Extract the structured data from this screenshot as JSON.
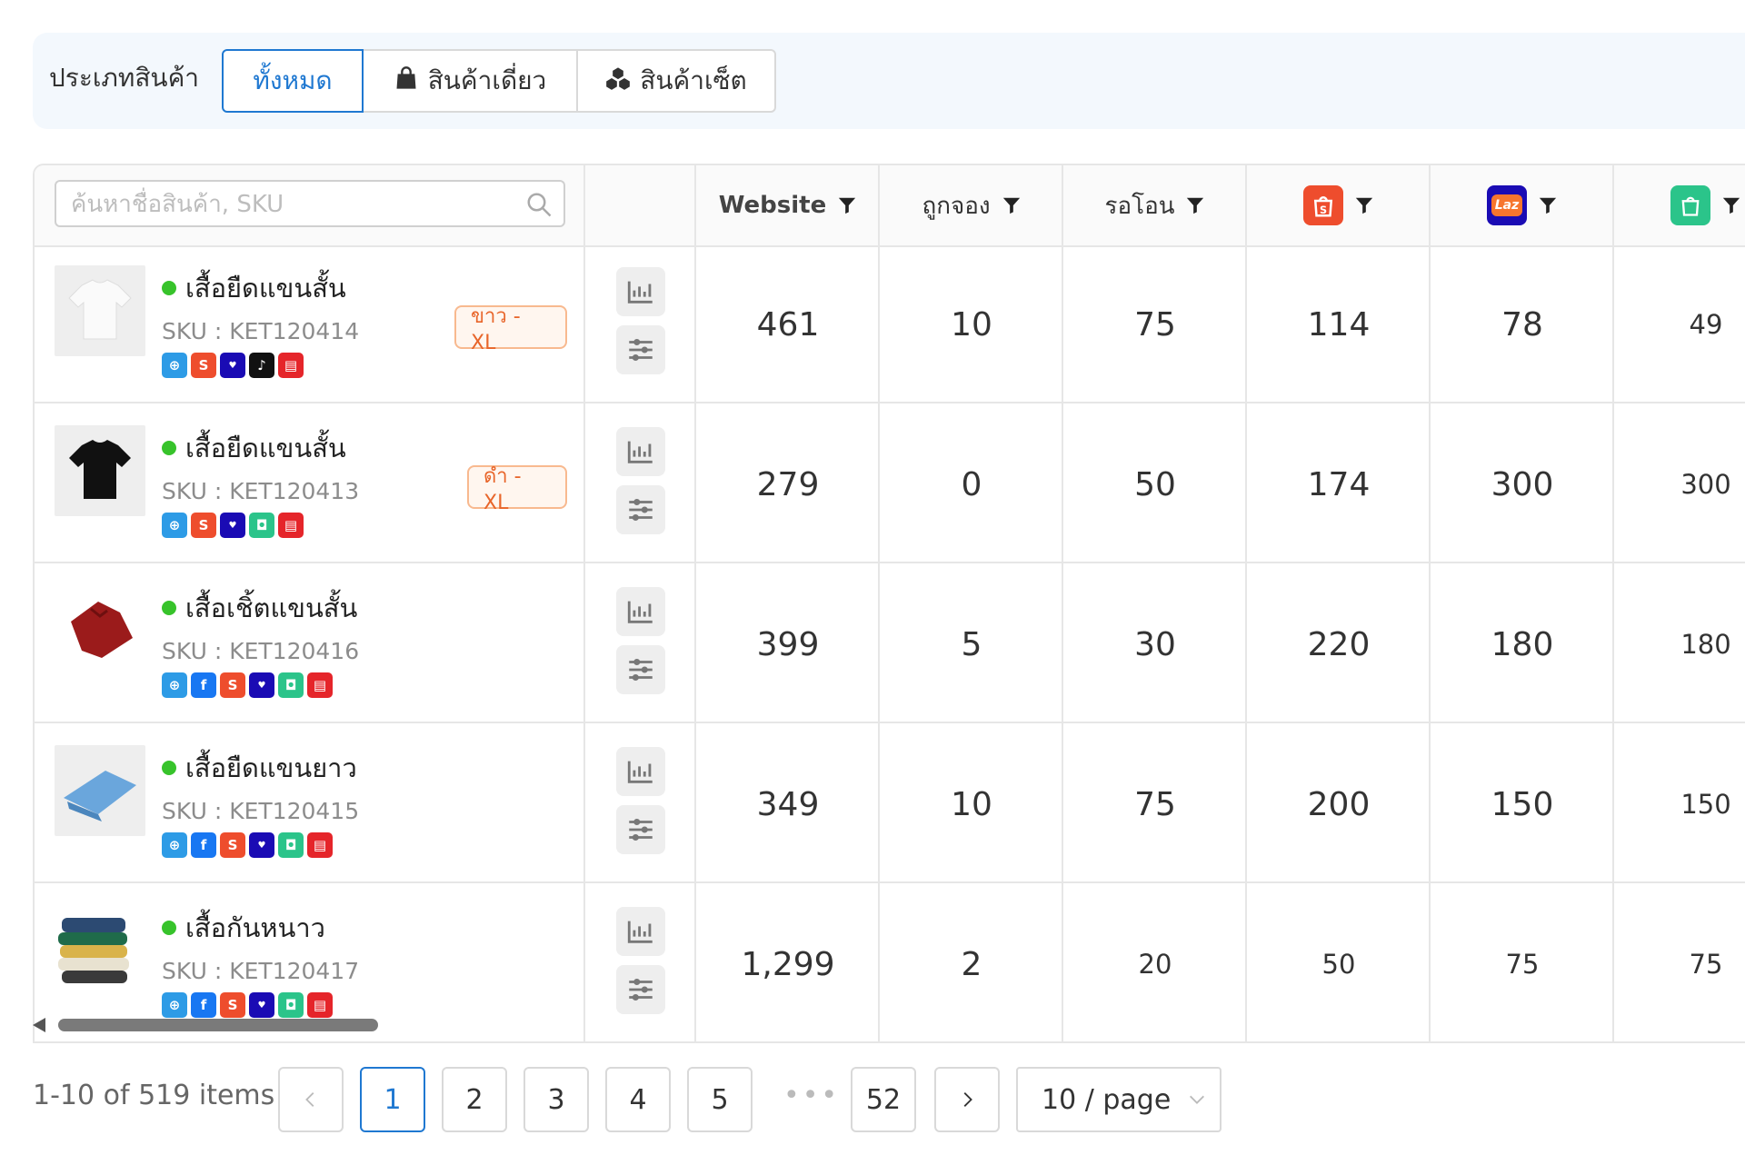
{
  "filter": {
    "label": "ประเภทสินค้า",
    "tabs": [
      {
        "label": "ทั้งหมด",
        "icon": "",
        "active": true
      },
      {
        "label": "สินค้าเดี่ยว",
        "icon": "shopping-bag-icon",
        "active": false
      },
      {
        "label": "สินค้าเซ็ต",
        "icon": "cubes-icon",
        "active": false
      }
    ]
  },
  "search": {
    "placeholder": "ค้นหาชื่อสินค้า, SKU",
    "value": ""
  },
  "columns": {
    "website": "Website",
    "reserved": "ถูกจอง",
    "pending": "รอโอน",
    "shopee_icon": "shopee-logo-icon",
    "lazada_icon": "lazada-logo-icon",
    "lazada_text": "Laz",
    "line_icon": "line-shopping-logo-icon"
  },
  "colors": {
    "accent": "#1f78d1",
    "shopee": "#ee4d2d",
    "lazada": "#1a0bb4",
    "line_shopping": "#2bc48a",
    "status_active": "#37c32b",
    "variant_text": "#e8652a"
  },
  "products": [
    {
      "name": "เสื้อยืดแขนสั้น",
      "sku": "SKU : KET120414",
      "variant": "ขาว - XL",
      "channels": [
        "website",
        "shopee",
        "lazada",
        "tiktok",
        "pos"
      ],
      "stock": {
        "website": "461",
        "reserved": "10",
        "pending": "75",
        "shopee": "114",
        "lazada": "78",
        "line": "49"
      }
    },
    {
      "name": "เสื้อยืดแขนสั้น",
      "sku": "SKU : KET120413",
      "variant": "ดำ - XL",
      "channels": [
        "website",
        "shopee",
        "lazada",
        "line",
        "pos"
      ],
      "stock": {
        "website": "279",
        "reserved": "0",
        "pending": "50",
        "shopee": "174",
        "lazada": "300",
        "line": "300"
      }
    },
    {
      "name": "เสื้อเชิ้ตแขนสั้น",
      "sku": "SKU : KET120416",
      "variant": "",
      "channels": [
        "website",
        "facebook",
        "shopee",
        "lazada",
        "line",
        "pos"
      ],
      "stock": {
        "website": "399",
        "reserved": "5",
        "pending": "30",
        "shopee": "220",
        "lazada": "180",
        "line": "180"
      }
    },
    {
      "name": "เสื้อยืดแขนยาว",
      "sku": "SKU : KET120415",
      "variant": "",
      "channels": [
        "website",
        "facebook",
        "shopee",
        "lazada",
        "line",
        "pos"
      ],
      "stock": {
        "website": "349",
        "reserved": "10",
        "pending": "75",
        "shopee": "200",
        "lazada": "150",
        "line": "150"
      }
    },
    {
      "name": "เสื้อกันหนาว",
      "sku": "SKU : KET120417",
      "variant": "",
      "channels": [
        "website",
        "facebook",
        "shopee",
        "lazada",
        "line",
        "pos"
      ],
      "stock": {
        "website": "1,299",
        "reserved": "2",
        "pending": "20",
        "shopee": "50",
        "lazada": "75",
        "line": "75"
      }
    }
  ],
  "pagination": {
    "total_text": "1-10 of 519 items",
    "pages": [
      "1",
      "2",
      "3",
      "4",
      "5"
    ],
    "current": "1",
    "ellipsis": "•••",
    "last": "52",
    "page_size": "10 / page"
  }
}
